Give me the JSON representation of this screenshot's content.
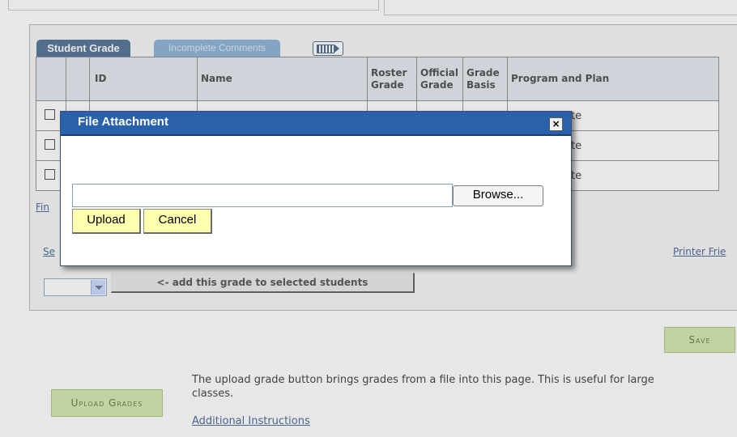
{
  "tabs": {
    "active_label": "Student Grade",
    "inactive_label": "Incomplete Comments",
    "view_all_icon": "grid-view-icon"
  },
  "grid": {
    "headers": {
      "id": "ID",
      "name": "Name",
      "roster_grade_1": "Roster",
      "roster_grade_2": "Grade",
      "official_grade_1": "Official",
      "official_grade_2": "Grade",
      "grade_basis_1": "Grade",
      "grade_basis_2": "Basis",
      "program_plan": "Program and Plan"
    },
    "rows": [
      {
        "program": "Arts Graduate"
      },
      {
        "program": "Arts Graduate"
      },
      {
        "program": "Arts Graduate"
      }
    ]
  },
  "links": {
    "find": "Fin",
    "select": "Se",
    "printer_friendly": "Printer Frie",
    "additional_instructions": "Additional Instructions"
  },
  "buttons": {
    "add_grade": "<- add this grade to selected students",
    "save": "Save",
    "upload_grades": "Upload Grades"
  },
  "info_text": "The upload grade button brings grades from a file into this page. This is useful for large classes.",
  "modal": {
    "title": "File Attachment",
    "close_glyph": "×",
    "file_value": "",
    "browse_label": "Browse...",
    "upload_label": "Upload",
    "cancel_label": "Cancel"
  }
}
